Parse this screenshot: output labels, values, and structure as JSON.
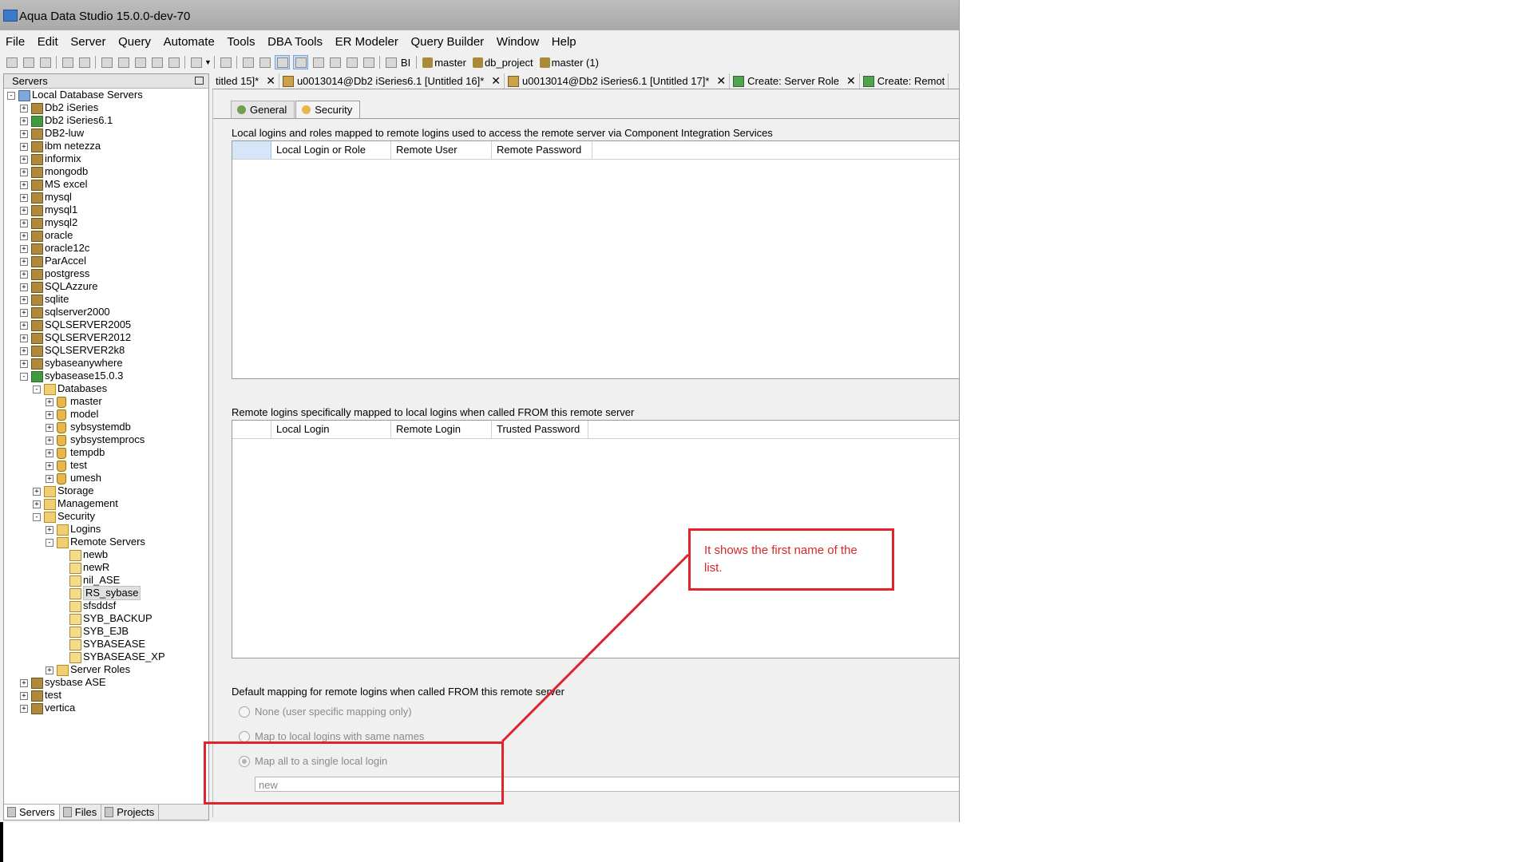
{
  "window": {
    "title": "Aqua Data Studio 15.0.0-dev-70"
  },
  "menu": [
    "File",
    "Edit",
    "Server",
    "Query",
    "Automate",
    "Tools",
    "DBA Tools",
    "ER Modeler",
    "Query Builder",
    "Window",
    "Help"
  ],
  "toolbar": {
    "bi_label": "BI",
    "db_labels": [
      "master",
      "db_project",
      "master (1)"
    ]
  },
  "left_panel": {
    "title": "Servers",
    "tree": [
      {
        "label": "Local Database Servers",
        "depth": 0,
        "state": "-",
        "icon": "root"
      },
      {
        "label": "Db2 iSeries",
        "depth": 1,
        "state": "+",
        "icon": "server"
      },
      {
        "label": "Db2 iSeries6.1",
        "depth": 1,
        "state": "+",
        "icon": "server-ok"
      },
      {
        "label": "DB2-luw",
        "depth": 1,
        "state": "+",
        "icon": "server"
      },
      {
        "label": "ibm netezza",
        "depth": 1,
        "state": "+",
        "icon": "server"
      },
      {
        "label": "informix",
        "depth": 1,
        "state": "+",
        "icon": "server"
      },
      {
        "label": "mongodb",
        "depth": 1,
        "state": "+",
        "icon": "server"
      },
      {
        "label": "MS excel",
        "depth": 1,
        "state": "+",
        "icon": "server"
      },
      {
        "label": "mysql",
        "depth": 1,
        "state": "+",
        "icon": "server"
      },
      {
        "label": "mysql1",
        "depth": 1,
        "state": "+",
        "icon": "server"
      },
      {
        "label": "mysql2",
        "depth": 1,
        "state": "+",
        "icon": "server"
      },
      {
        "label": "oracle",
        "depth": 1,
        "state": "+",
        "icon": "server"
      },
      {
        "label": "oracle12c",
        "depth": 1,
        "state": "+",
        "icon": "server"
      },
      {
        "label": "ParAccel",
        "depth": 1,
        "state": "+",
        "icon": "server"
      },
      {
        "label": "postgress",
        "depth": 1,
        "state": "+",
        "icon": "server"
      },
      {
        "label": "SQLAzzure",
        "depth": 1,
        "state": "+",
        "icon": "server"
      },
      {
        "label": "sqlite",
        "depth": 1,
        "state": "+",
        "icon": "server"
      },
      {
        "label": "sqlserver2000",
        "depth": 1,
        "state": "+",
        "icon": "server"
      },
      {
        "label": "SQLSERVER2005",
        "depth": 1,
        "state": "+",
        "icon": "server"
      },
      {
        "label": "SQLSERVER2012",
        "depth": 1,
        "state": "+",
        "icon": "server"
      },
      {
        "label": "SQLSERVER2k8",
        "depth": 1,
        "state": "+",
        "icon": "server"
      },
      {
        "label": "sybaseanywhere",
        "depth": 1,
        "state": "+",
        "icon": "server"
      },
      {
        "label": "sybasease15.0.3",
        "depth": 1,
        "state": "-",
        "icon": "server-ok"
      },
      {
        "label": "Databases",
        "depth": 2,
        "state": "-",
        "icon": "folder"
      },
      {
        "label": "master",
        "depth": 3,
        "state": "+",
        "icon": "db"
      },
      {
        "label": "model",
        "depth": 3,
        "state": "+",
        "icon": "db"
      },
      {
        "label": "sybsystemdb",
        "depth": 3,
        "state": "+",
        "icon": "db"
      },
      {
        "label": "sybsystemprocs",
        "depth": 3,
        "state": "+",
        "icon": "db"
      },
      {
        "label": "tempdb",
        "depth": 3,
        "state": "+",
        "icon": "db"
      },
      {
        "label": "test",
        "depth": 3,
        "state": "+",
        "icon": "db"
      },
      {
        "label": "umesh",
        "depth": 3,
        "state": "+",
        "icon": "db"
      },
      {
        "label": "Storage",
        "depth": 2,
        "state": "+",
        "icon": "folder"
      },
      {
        "label": "Management",
        "depth": 2,
        "state": "+",
        "icon": "folder"
      },
      {
        "label": "Security",
        "depth": 2,
        "state": "-",
        "icon": "folder"
      },
      {
        "label": "Logins",
        "depth": 3,
        "state": "+",
        "icon": "folder"
      },
      {
        "label": "Remote Servers",
        "depth": 3,
        "state": "-",
        "icon": "folder"
      },
      {
        "label": "newb",
        "depth": 4,
        "state": "",
        "icon": "remote"
      },
      {
        "label": "newR",
        "depth": 4,
        "state": "",
        "icon": "remote"
      },
      {
        "label": "nil_ASE",
        "depth": 4,
        "state": "",
        "icon": "remote"
      },
      {
        "label": "RS_sybase",
        "depth": 4,
        "state": "",
        "icon": "remote",
        "selected": true
      },
      {
        "label": "sfsddsf",
        "depth": 4,
        "state": "",
        "icon": "remote"
      },
      {
        "label": "SYB_BACKUP",
        "depth": 4,
        "state": "",
        "icon": "remote"
      },
      {
        "label": "SYB_EJB",
        "depth": 4,
        "state": "",
        "icon": "remote"
      },
      {
        "label": "SYBASEASE",
        "depth": 4,
        "state": "",
        "icon": "remote"
      },
      {
        "label": "SYBASEASE_XP",
        "depth": 4,
        "state": "",
        "icon": "remote"
      },
      {
        "label": "Server Roles",
        "depth": 3,
        "state": "+",
        "icon": "folder"
      },
      {
        "label": "sysbase ASE",
        "depth": 1,
        "state": "+",
        "icon": "server"
      },
      {
        "label": "test",
        "depth": 1,
        "state": "+",
        "icon": "server"
      },
      {
        "label": "vertica",
        "depth": 1,
        "state": "+",
        "icon": "server"
      }
    ],
    "bottom_tabs": [
      "Servers",
      "Files",
      "Projects"
    ]
  },
  "editor_tabs": [
    {
      "label": "titled 15]*",
      "icon": ""
    },
    {
      "label": "u0013014@Db2 iSeries6.1 [Untitled 16]*",
      "icon": "query"
    },
    {
      "label": "u0013014@Db2 iSeries6.1 [Untitled 17]*",
      "icon": "query"
    },
    {
      "label": "Create: Server Role",
      "icon": "create"
    },
    {
      "label": "Create: Remot",
      "icon": "create"
    }
  ],
  "inner_tabs": [
    "General",
    "Security"
  ],
  "security": {
    "section1_label": "Local logins and roles mapped to remote logins used to access the remote server via Component Integration Services",
    "grid1_columns": [
      "Local Login or Role",
      "Remote User",
      "Remote Password"
    ],
    "section2_label": "Remote logins specifically mapped to local logins when called FROM this remote server",
    "grid2_columns": [
      "Local Login",
      "Remote Login",
      "Trusted Password"
    ],
    "section3_label": "Default mapping for remote logins when called FROM this remote server",
    "radio_options": [
      "None (user specific mapping only)",
      "Map to local logins with same names",
      "Map all to a single local login"
    ],
    "selected_option": 2,
    "login_value": "new"
  },
  "annotation": {
    "text": "It shows the first name of the list.",
    "color": "#e0242b"
  }
}
